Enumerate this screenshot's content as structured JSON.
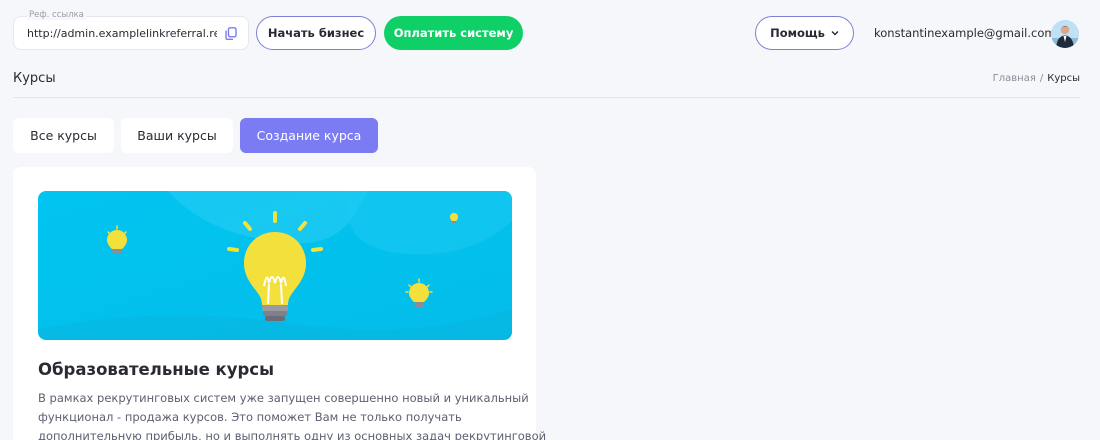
{
  "topbar": {
    "ref_label": "Реф. ссылка",
    "ref_value": "http://admin.examplelinkreferral.re...",
    "start_business": "Начать бизнес",
    "pay_system": "Оплатить систему",
    "help": "Помощь",
    "user_email": "konstantinexample@gmail.com"
  },
  "header": {
    "title": "Курсы",
    "breadcrumb": {
      "home": "Главная",
      "separator": "/",
      "current": "Курсы"
    }
  },
  "tabs": [
    {
      "label": "Все курсы"
    },
    {
      "label": "Ваши курсы"
    },
    {
      "label": "Создание курса",
      "active": true
    }
  ],
  "card": {
    "title": "Образовательные курсы",
    "text_lines": [
      "В рамках рекрутинговых систем уже запущен совершенно новый и уникальный",
      "функционал - продажа курсов. Это поможет Вам не только получать",
      "дополнительную прибыль, но и выполнять одну из основных задач рекрутинговой"
    ]
  },
  "icons": {
    "copy": "copy-icon",
    "help_chevron": "chevron-down-icon",
    "user_chevron": "chevron-down-icon",
    "banner": "lightbulb-illustration"
  },
  "colors": {
    "accent": "#7b7cf4",
    "pay_green": "#0fd067",
    "banner_blue": "#04c3ee",
    "outline": "#7c7fd6",
    "background": "#f6f7fb"
  }
}
